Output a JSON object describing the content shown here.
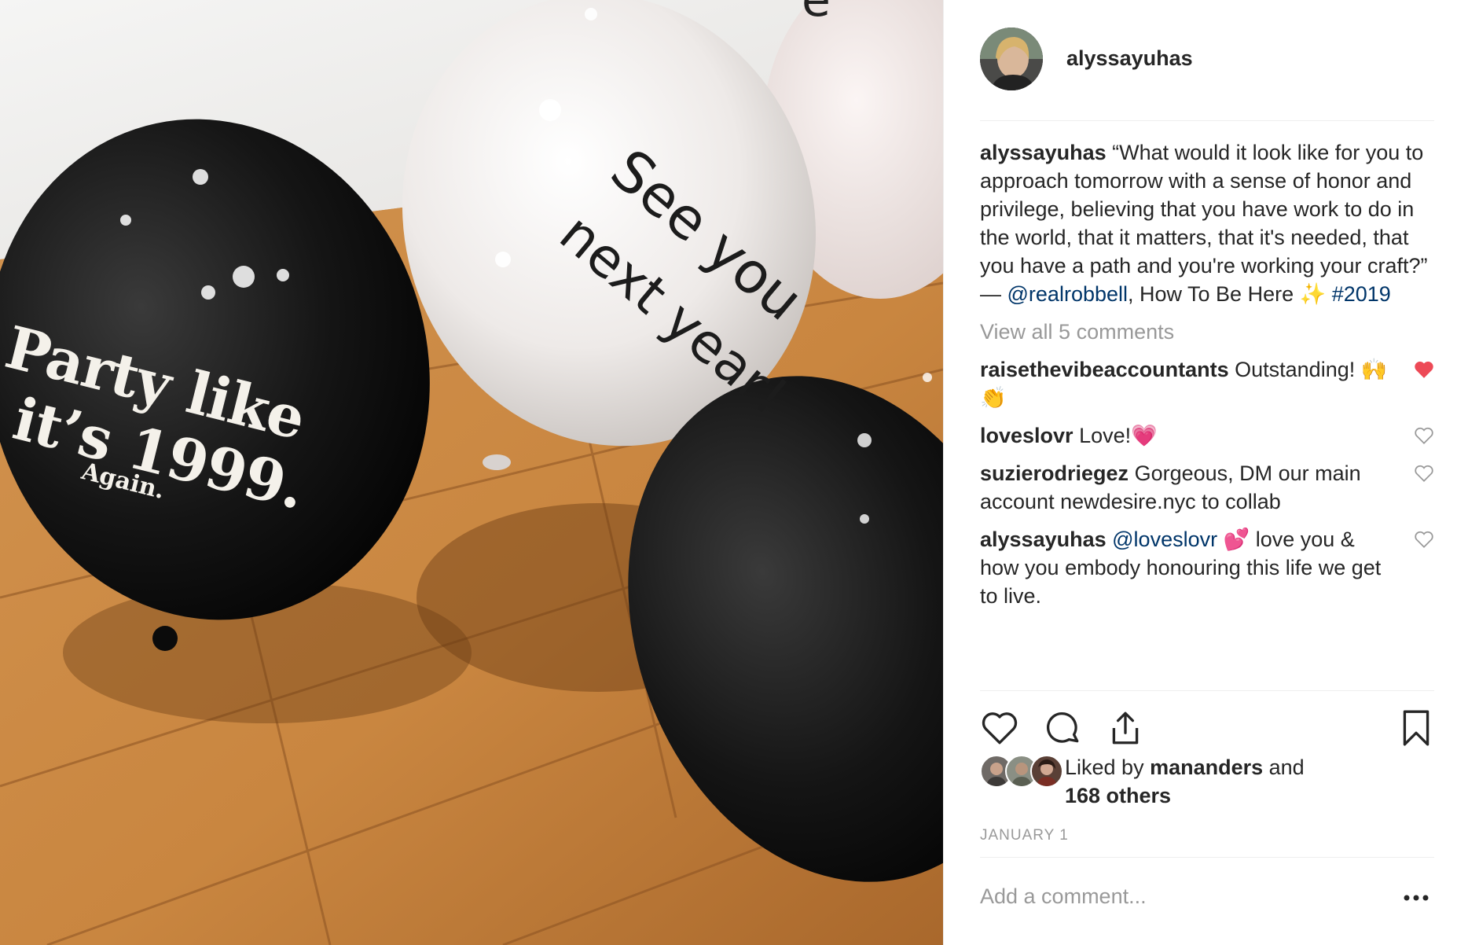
{
  "photo": {
    "balloon_text_1_line1": "Party like",
    "balloon_text_1_line2": "it’s 1999.",
    "balloon_text_1_line3": "Again.",
    "balloon_text_2_line1": "See you",
    "balloon_text_2_line2": "next year!"
  },
  "header": {
    "username": "alyssayuhas",
    "avatar_icon": "profile-avatar"
  },
  "caption": {
    "username": "alyssayuhas",
    "text_before_mention": " “What would it look like for you to approach tomorrow with a sense of honor and privilege, believing that you have work to do in the world, that it matters, that it's needed, that you have a path and you're working your craft?” — ",
    "mention": "@realrobbell",
    "text_after_mention": ", How To Be Here ✨ ",
    "hashtag": "#2019"
  },
  "view_all_comments": "View all 5 comments",
  "comments": [
    {
      "username": "raisethevibeaccountants",
      "text": " Outstanding! 🙌 👏",
      "liked": true
    },
    {
      "username": "loveslovr",
      "text": " Love!💗",
      "liked": false
    },
    {
      "username": "suzierodriegez",
      "text": " Gorgeous, DM our main account newdesire.nyc to collab",
      "liked": false
    },
    {
      "username": "alyssayuhas",
      "mention": "@loveslovr",
      "text": " 💕  love you & how you embody honouring this life we get to live.",
      "liked": false
    }
  ],
  "actions": {
    "like_icon": "heart-outline-icon",
    "comment_icon": "comment-bubble-icon",
    "share_icon": "share-upload-icon",
    "save_icon": "bookmark-icon"
  },
  "likes": {
    "prefix": "Liked by ",
    "user": "mananders",
    "connector": " and",
    "others": "168 others"
  },
  "date": "JANUARY 1",
  "add_comment": {
    "placeholder": "Add a comment..."
  },
  "colors": {
    "text": "#262626",
    "muted": "#999999",
    "link": "#003569",
    "heart_red": "#ed4956",
    "divider": "#efefef"
  }
}
